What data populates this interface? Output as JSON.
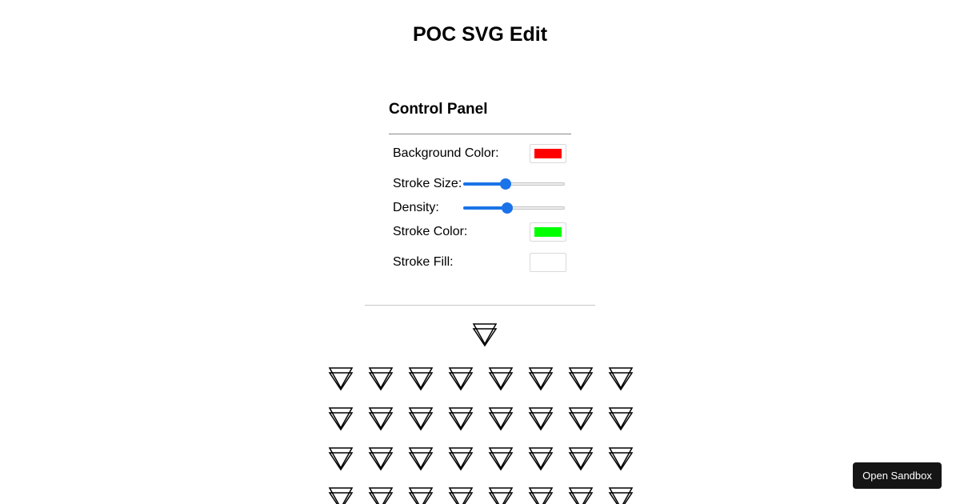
{
  "page": {
    "title": "POC SVG Edit"
  },
  "control_panel": {
    "title": "Control Panel",
    "background_color": {
      "label": "Background Color:",
      "value": "#ff0000"
    },
    "stroke_size": {
      "label": "Stroke Size:",
      "value_fraction": 0.41
    },
    "density": {
      "label": "Density:",
      "value_fraction": 0.43
    },
    "stroke_color": {
      "label": "Stroke Color:",
      "value": "#00ff00"
    },
    "stroke_fill": {
      "label": "Stroke Fill:",
      "value": "#ffffff"
    }
  },
  "preview": {
    "icon": "double-triangle-icon",
    "grid_columns": 8,
    "grid_rows_visible": 4,
    "stroke_color": "#000000"
  },
  "sandbox": {
    "button_label": "Open Sandbox"
  },
  "colors": {
    "slider_accent": "#1a73e8",
    "button_dark": "#151515"
  }
}
